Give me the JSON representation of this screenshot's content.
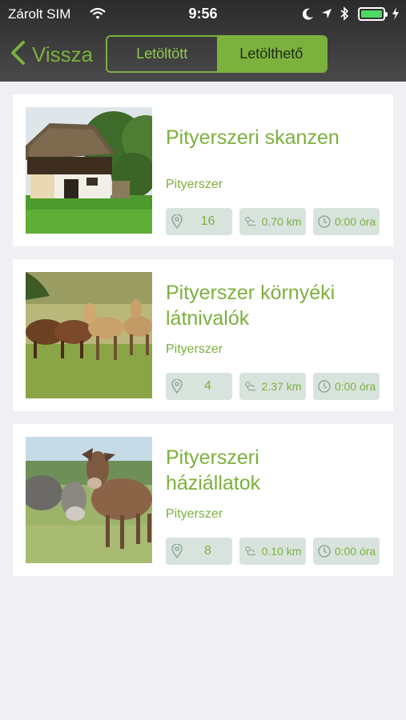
{
  "status": {
    "carrier": "Zárolt SIM",
    "time": "9:56",
    "icons": [
      "wifi-icon",
      "moon-icon",
      "location-arrow-icon",
      "bluetooth-icon",
      "battery-icon",
      "charging-bolt-icon"
    ]
  },
  "nav": {
    "back_label": "Vissza",
    "tabs": [
      {
        "label": "Letöltött",
        "selected": false
      },
      {
        "label": "Letölthető",
        "selected": true
      }
    ]
  },
  "colors": {
    "accent": "#7bb13d",
    "badge_bg": "#d9e3dd",
    "page_bg": "#efeff4"
  },
  "tours": [
    {
      "title": "Pityerszeri skanzen",
      "location": "Pityerszer",
      "points": "16",
      "distance": "0.70 km",
      "duration": "0:00 óra",
      "image": "thatched-farmhouse-photo"
    },
    {
      "title": "Pityerszer környéki látnivalók",
      "location": "Pityerszer",
      "points": "4",
      "distance": "2.37 km",
      "duration": "0:00 óra",
      "image": "wild-horses-photo"
    },
    {
      "title": "Pityerszeri háziállatok",
      "location": "Pityerszer",
      "points": "8",
      "distance": "0.10 km",
      "duration": "0:00 óra",
      "image": "donkeys-photo"
    }
  ]
}
